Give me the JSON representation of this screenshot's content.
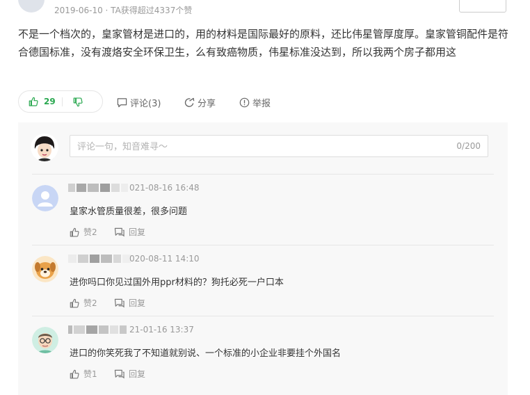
{
  "previous_answer": {
    "meta": "2019-06-10 · TA获得超过4337个赞"
  },
  "answer": {
    "text": "不是一个档次的，皇家管材是进口的，用的材料是国际最好的原料，还比伟星管厚度厚。皇家管铜配件是符合德国标准，没有渡烙安全环保卫生，么有致癌物质，伟星标准没达到，所以我两个房子都用这"
  },
  "actions": {
    "like_count": "29",
    "comment_label": "评论(3)",
    "share_label": "分享",
    "report_label": "举报"
  },
  "comment_box": {
    "placeholder": "评论一句，知音难寻～",
    "counter": "0/200"
  },
  "comments": [
    {
      "time": "021-08-16 16:48",
      "text": "皇家水管质量很差，很多问题",
      "likes": "赞2",
      "reply": "回复"
    },
    {
      "time": "020-08-11 14:10",
      "text": "进你吗口你见过国外用ppr材料的？狗托必死一户口本",
      "likes": "赞2",
      "reply": "回复"
    },
    {
      "time": "21-01-16 13:37",
      "text": "进口的你笑死我了不知道就别说、一个标准的小企业非要挂个外国名",
      "likes": "赞1",
      "reply": "回复"
    }
  ],
  "colors": {
    "like_green": "#2aa850",
    "panel_bg": "#f8f8f8"
  }
}
